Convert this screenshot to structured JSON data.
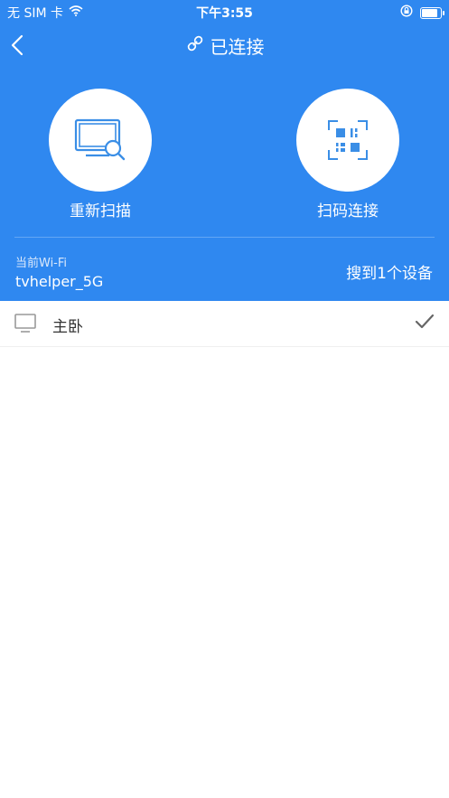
{
  "status_bar": {
    "carrier": "无 SIM 卡",
    "time": "下午3:55"
  },
  "nav": {
    "title": "已连接"
  },
  "actions": {
    "rescan_label": "重新扫描",
    "scan_code_label": "扫码连接"
  },
  "wifi": {
    "label": "当前Wi-Fi",
    "name": "tvhelper_5G",
    "found": "搜到1个设备"
  },
  "devices": [
    {
      "name": "主卧",
      "selected": true
    }
  ],
  "colors": {
    "primary": "#2f88f0",
    "icon_blue": "#3a8ee6",
    "check_gray": "#666666"
  }
}
